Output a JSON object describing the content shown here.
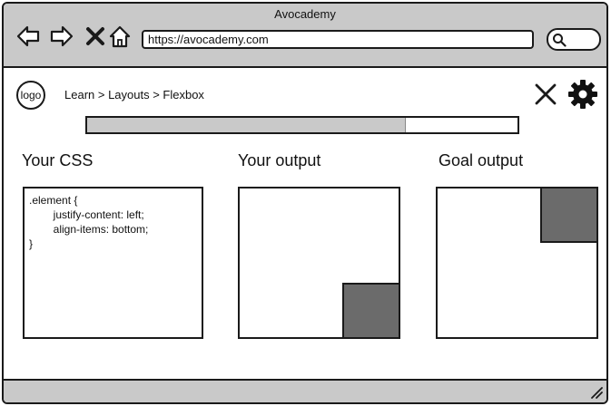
{
  "window": {
    "title": "Avocademy"
  },
  "browser": {
    "url": "https://avocademy.com",
    "icons": [
      "back-arrow-icon",
      "forward-arrow-icon",
      "stop-icon",
      "home-icon",
      "search-icon"
    ]
  },
  "header": {
    "logo_text": "logo",
    "breadcrumb": "Learn > Layouts > Flexbox",
    "icons": [
      "close-icon",
      "gear-icon"
    ]
  },
  "progress": {
    "value": 0.74
  },
  "sections": {
    "css_title": "Your CSS",
    "output_title": "Your output",
    "goal_title": "Goal output"
  },
  "css_editor": {
    "code": ".element {\n        justify-content: left;\n        align-items: bottom;\n}"
  },
  "colors": {
    "chrome": "#c9c9c9",
    "box_fill": "#6b6b6b",
    "border": "#1a1a1a"
  }
}
